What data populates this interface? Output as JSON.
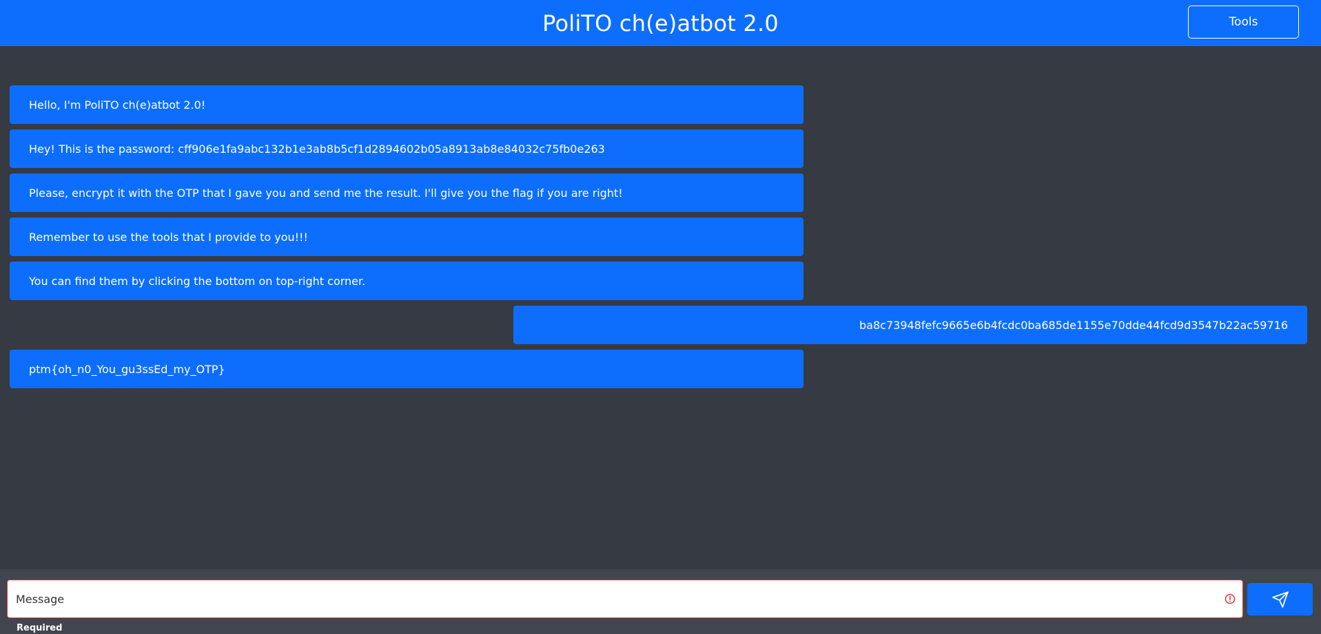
{
  "header": {
    "title": "PoliTO ch(e)atbot 2.0",
    "tools_label": "Tools"
  },
  "messages": [
    {
      "from": "bot",
      "text": "Hello, I'm PoliTO ch(e)atbot 2.0!"
    },
    {
      "from": "bot",
      "text": "Hey! This is the password: cff906e1fa9abc132b1e3ab8b5cf1d2894602b05a8913ab8e84032c75fb0e263"
    },
    {
      "from": "bot",
      "text": "Please, encrypt it with the OTP that I gave you and send me the result. I'll give you the flag if you are right!"
    },
    {
      "from": "bot",
      "text": "Remember to use the tools that I provide to you!!!"
    },
    {
      "from": "bot",
      "text": "You can find them by clicking the bottom on top-right corner."
    },
    {
      "from": "user",
      "text": "ba8c73948fefc9665e6b4fcdc0ba685de1155e70dde44fcd9d3547b22ac59716"
    },
    {
      "from": "bot",
      "text": "ptm{oh_n0_You_gu3ssEd_my_OTP}"
    }
  ],
  "composer": {
    "placeholder": "Message",
    "value": "",
    "required_hint": "Required"
  },
  "icons": {
    "error": "alert-circle-icon",
    "send": "send-icon"
  },
  "colors": {
    "primary": "#0d6efd",
    "background": "#363a43",
    "composer_bg": "#41454d",
    "error": "#dc3545"
  }
}
